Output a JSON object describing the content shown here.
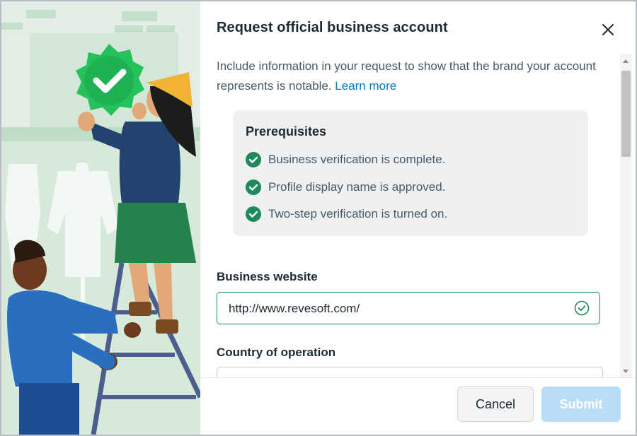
{
  "dialog": {
    "title": "Request official business account",
    "close_icon": "close-icon",
    "description": "Include information in your request to show that the brand your account represents is notable.",
    "learn_more": "Learn more"
  },
  "prerequisites": {
    "heading": "Prerequisites",
    "items": [
      {
        "label": "Business verification is complete.",
        "icon": "check-circle-icon"
      },
      {
        "label": "Profile display name is approved.",
        "icon": "check-circle-icon"
      },
      {
        "label": "Two-step verification is turned on.",
        "icon": "check-circle-icon"
      }
    ]
  },
  "form": {
    "website_label": "Business website",
    "website_value": "http://www.revesoft.com/",
    "website_status_icon": "check-circle-outline-icon",
    "country_label": "Country of operation",
    "country_value": ""
  },
  "footer": {
    "cancel_label": "Cancel",
    "submit_label": "Submit"
  },
  "colors": {
    "accent_green": "#1e8a5b",
    "link_blue": "#0a78be",
    "submit_disabled": "#b9dcf7",
    "illustration_bg": "#e3efe6"
  }
}
